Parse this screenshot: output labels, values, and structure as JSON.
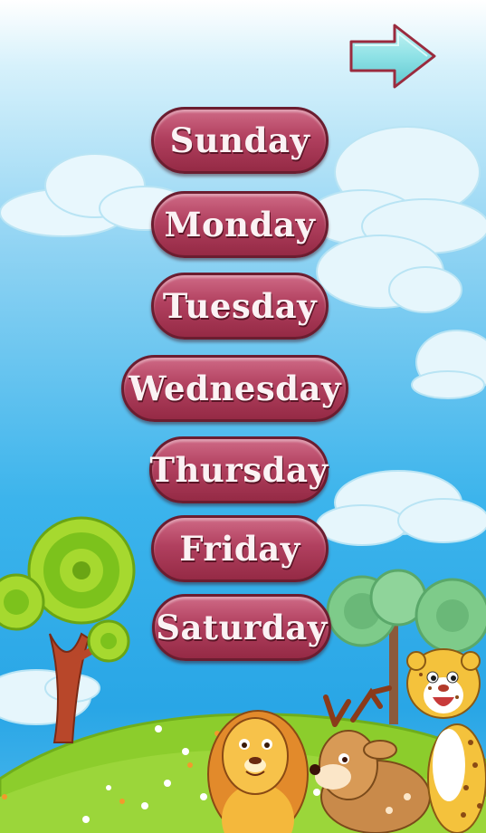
{
  "navigation": {
    "next_icon": "right-arrow-icon"
  },
  "days": [
    {
      "label": "Sunday"
    },
    {
      "label": "Monday"
    },
    {
      "label": "Tuesday"
    },
    {
      "label": "Wednesday"
    },
    {
      "label": "Thursday"
    },
    {
      "label": "Friday"
    },
    {
      "label": "Saturday"
    }
  ],
  "colors": {
    "button_fill": "#b1405f",
    "button_border": "#6b1d30",
    "button_text": "#fbf2f4",
    "sky": "#3cb4ec",
    "grass": "#8ccd2c",
    "arrow_fill": "#8fe2e6",
    "arrow_outline": "#9a2b3e"
  }
}
